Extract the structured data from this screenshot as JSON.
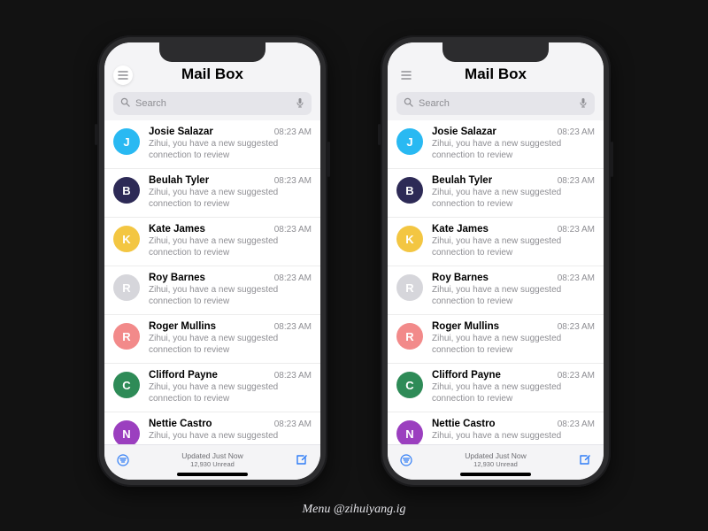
{
  "caption": "Menu @zihuiyang.ig",
  "phones": [
    {
      "menuCircled": true
    },
    {
      "menuCircled": false
    }
  ],
  "header": {
    "title": "Mail Box"
  },
  "search": {
    "placeholder": "Search"
  },
  "footer": {
    "updated": "Updated Just Now",
    "unread": "12,930 Unread"
  },
  "messages": [
    {
      "initial": "J",
      "color": "#29b9f2",
      "sender": "Josie Salazar",
      "time": "08:23 AM",
      "snippet": "Zihui, you have a new suggested connection to review"
    },
    {
      "initial": "B",
      "color": "#2d2a56",
      "sender": "Beulah Tyler",
      "time": "08:23 AM",
      "snippet": "Zihui, you have a new suggested connection to review"
    },
    {
      "initial": "K",
      "color": "#f3c642",
      "sender": "Kate James",
      "time": "08:23 AM",
      "snippet": "Zihui, you have a new suggested connection to review"
    },
    {
      "initial": "R",
      "color": "#d6d6db",
      "sender": "Roy Barnes",
      "time": "08:23 AM",
      "snippet": "Zihui, you have a new suggested connection to review"
    },
    {
      "initial": "R",
      "color": "#f28a8a",
      "sender": "Roger Mullins",
      "time": "08:23 AM",
      "snippet": "Zihui, you have a new suggested connection to review"
    },
    {
      "initial": "C",
      "color": "#2e8b57",
      "sender": "Clifford Payne",
      "time": "08:23 AM",
      "snippet": "Zihui, you have a new suggested connection to review"
    },
    {
      "initial": "N",
      "color": "#9b3fbf",
      "sender": "Nettie Castro",
      "time": "08:23 AM",
      "snippet": "Zihui, you have a new suggested"
    }
  ]
}
